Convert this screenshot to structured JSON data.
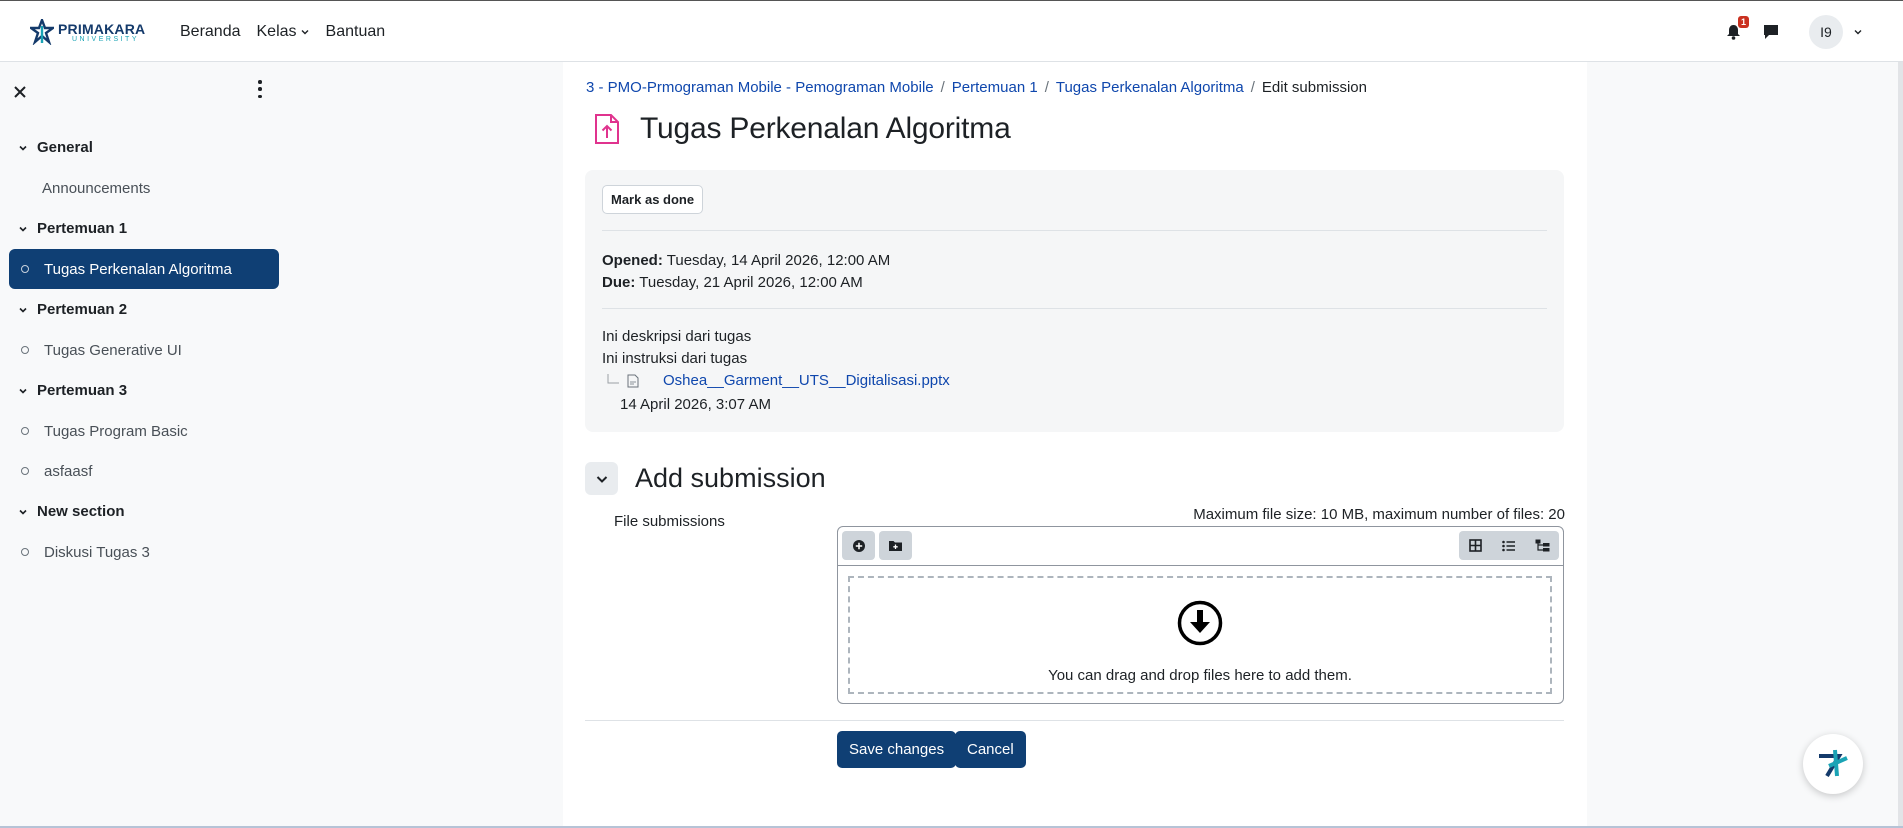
{
  "navbar": {
    "logo_main": "PRIMAKARA",
    "logo_sub": "UNIVERSITY",
    "links": [
      "Beranda",
      "Kelas",
      "Bantuan"
    ],
    "notification_count": "1",
    "avatar_initials": "I9"
  },
  "sidebar": {
    "sections": [
      {
        "title": "General",
        "items": [
          {
            "label": "Announcements"
          }
        ]
      },
      {
        "title": "Pertemuan 1",
        "items": [
          {
            "label": "Tugas Perkenalan Algoritma",
            "active": true
          }
        ]
      },
      {
        "title": "Pertemuan 2",
        "items": [
          {
            "label": "Tugas Generative UI"
          }
        ]
      },
      {
        "title": "Pertemuan 3",
        "items": [
          {
            "label": "Tugas Program Basic"
          },
          {
            "label": "asfaasf"
          }
        ]
      },
      {
        "title": "New section",
        "items": [
          {
            "label": "Diskusi Tugas 3"
          }
        ]
      }
    ]
  },
  "breadcrumb": [
    "3 - PMO-Prmograman Mobile - Pemograman Mobile",
    "Pertemuan 1",
    "Tugas Perkenalan Algoritma",
    "Edit submission"
  ],
  "page_title": "Tugas Perkenalan Algoritma",
  "activity": {
    "mark_done_label": "Mark as done",
    "opened_label": "Opened:",
    "opened_value": "Tuesday, 14 April 2026, 12:00 AM",
    "due_label": "Due:",
    "due_value": "Tuesday, 21 April 2026, 12:00 AM",
    "description": "Ini deskripsi dari tugas",
    "instructions": "Ini instruksi dari tugas",
    "file_name": "Oshea__Garment__UTS__Digitalisasi.pptx",
    "file_date": "14 April 2026, 3:07 AM"
  },
  "submission": {
    "heading": "Add submission",
    "file_label": "File submissions",
    "max_info": "Maximum file size: 10 MB, maximum number of files: 20",
    "drop_text": "You can drag and drop files here to add them.",
    "save_label": "Save changes",
    "cancel_label": "Cancel"
  },
  "colors": {
    "primary": "#0f3f74",
    "link": "#0f47ad",
    "assign_icon": "#e0338e",
    "badge": "#ca3120"
  }
}
